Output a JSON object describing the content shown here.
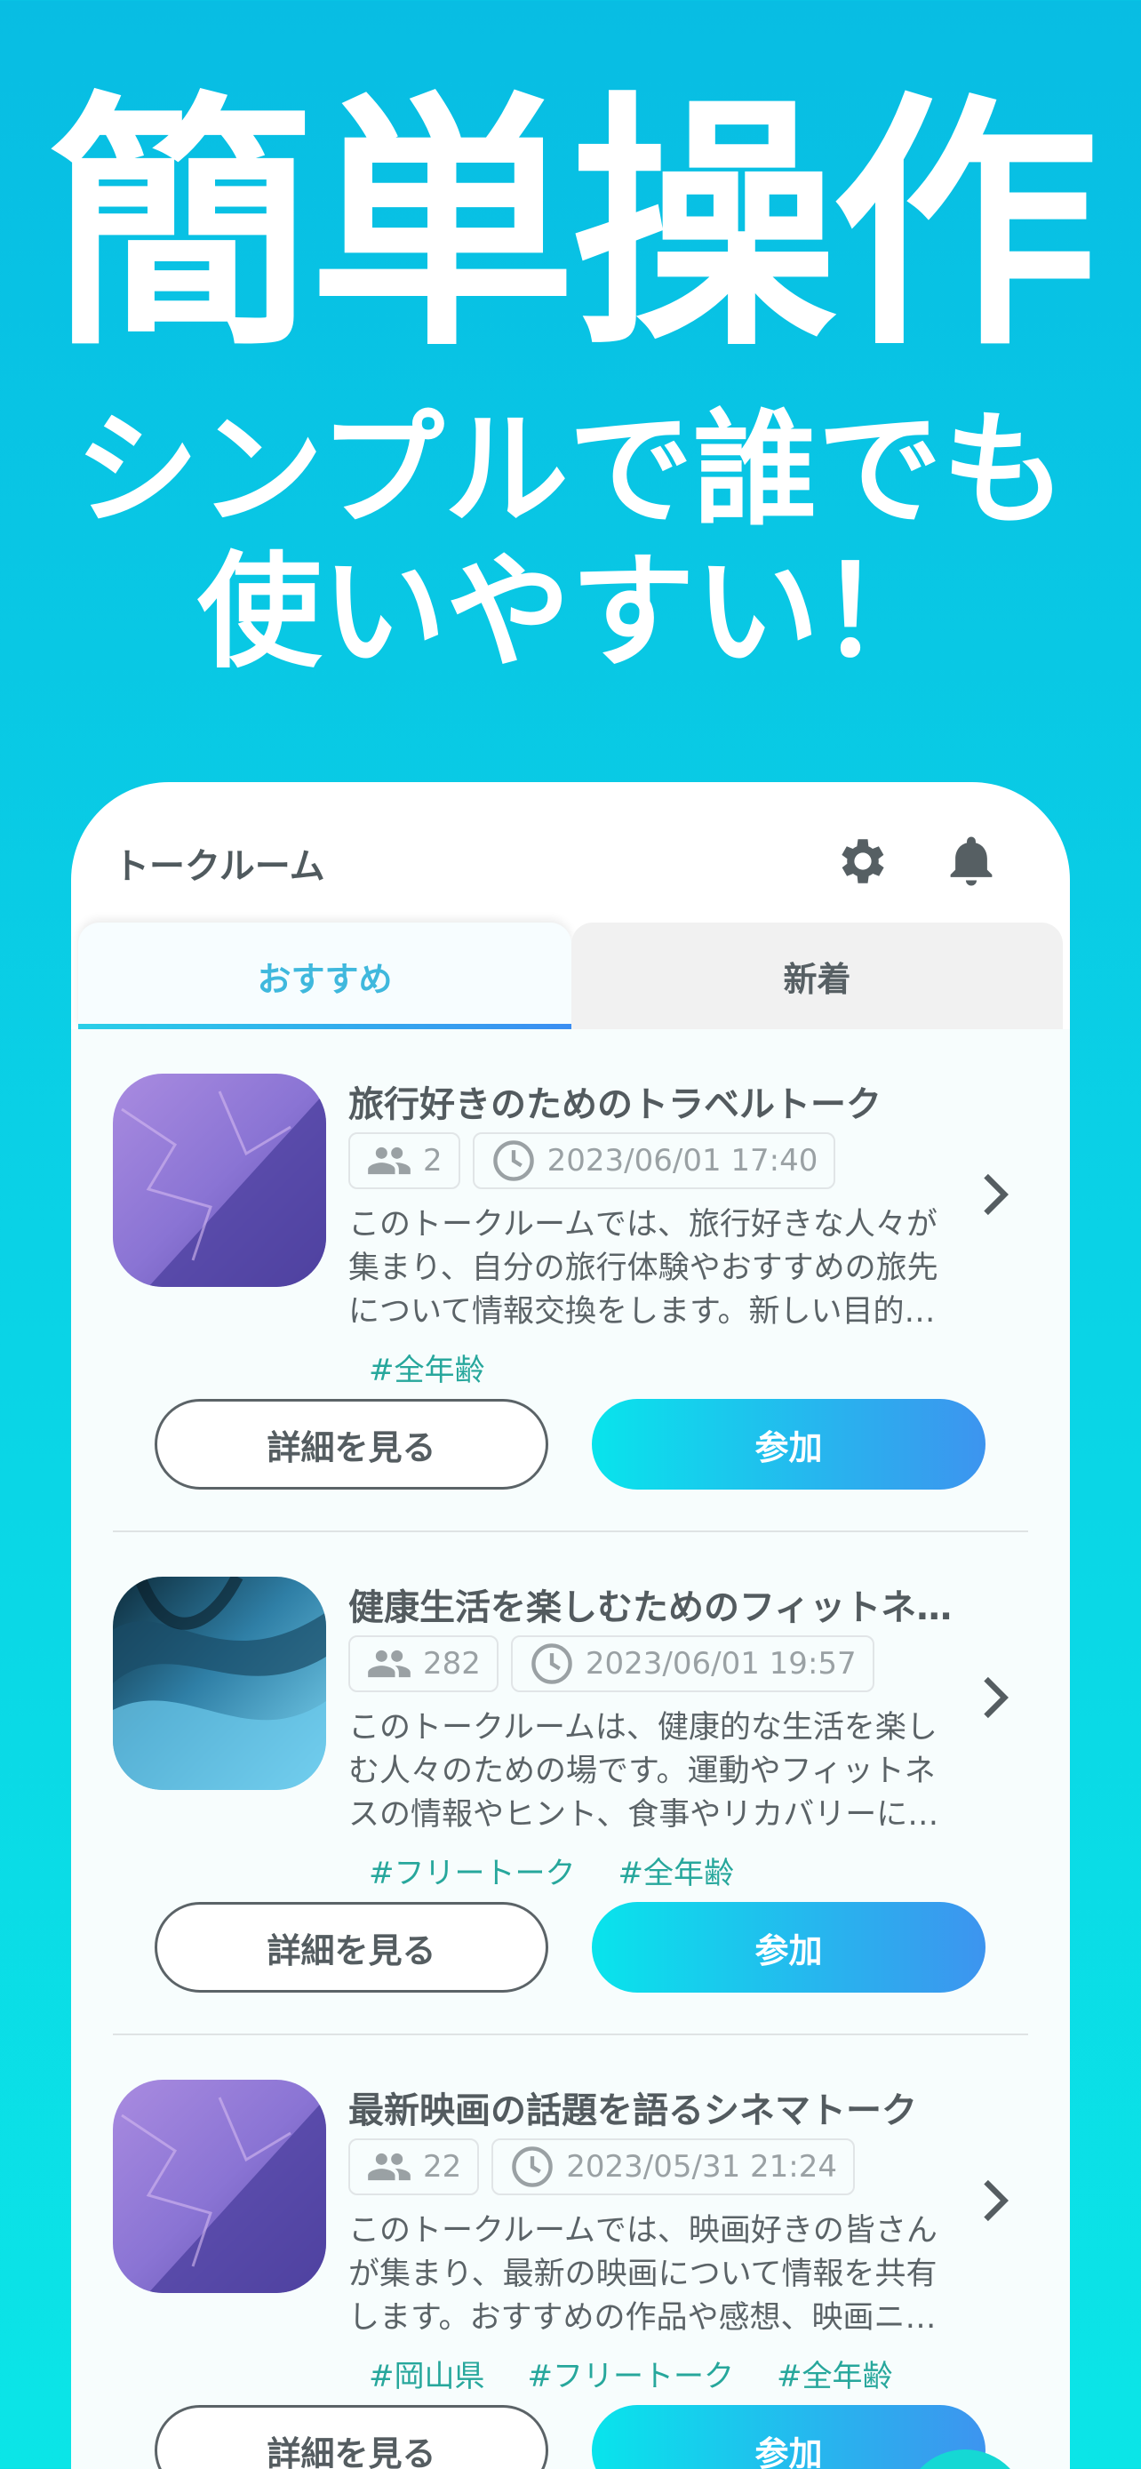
{
  "hero": {
    "title": "簡単操作",
    "subtitle_line1": "シンプルで誰でも",
    "subtitle_line2": "使いやすい！"
  },
  "app": {
    "header_title": "トークルーム",
    "icons": [
      "gear-icon",
      "bell-icon"
    ],
    "tabs": [
      {
        "label": "おすすめ",
        "selected": true
      },
      {
        "label": "新着",
        "selected": false
      }
    ],
    "accent_color": "#3fb8dd",
    "tag_color": "#27a79c",
    "rooms": [
      {
        "title": "旅行好きのためのトラベルトーク",
        "members": "2",
        "datetime": "2023/06/01 17:40",
        "description": "このトークルームでは、旅行好きな人々が集まり、自分の旅行体験やおすすめの旅先について情報交換をします。新しい目的…",
        "tags": [
          "#全年齢"
        ],
        "thumbnail": "purple-crumpled-paper",
        "detail_label": "詳細を見る",
        "join_label": "参加"
      },
      {
        "title": "健康生活を楽しむためのフィットネ…",
        "members": "282",
        "datetime": "2023/06/01 19:57",
        "description": "このトークルームは、健康的な生活を楽しむ人々のための場です。運動やフィットネスの情報やヒント、食事やリカバリーに…",
        "tags": [
          "#フリートーク",
          "#全年齢"
        ],
        "thumbnail": "blue-silk-waves",
        "detail_label": "詳細を見る",
        "join_label": "参加"
      },
      {
        "title": "最新映画の話題を語るシネマトーク",
        "members": "22",
        "datetime": "2023/05/31 21:24",
        "description": "このトークルームでは、映画好きの皆さんが集まり、最新の映画について情報を共有します。おすすめの作品や感想、映画ニ…",
        "tags": [
          "#岡山県",
          "#フリートーク",
          "#全年齢"
        ],
        "thumbnail": "purple-crumpled-paper",
        "detail_label": "詳細を見る",
        "join_label": "参加"
      }
    ]
  }
}
